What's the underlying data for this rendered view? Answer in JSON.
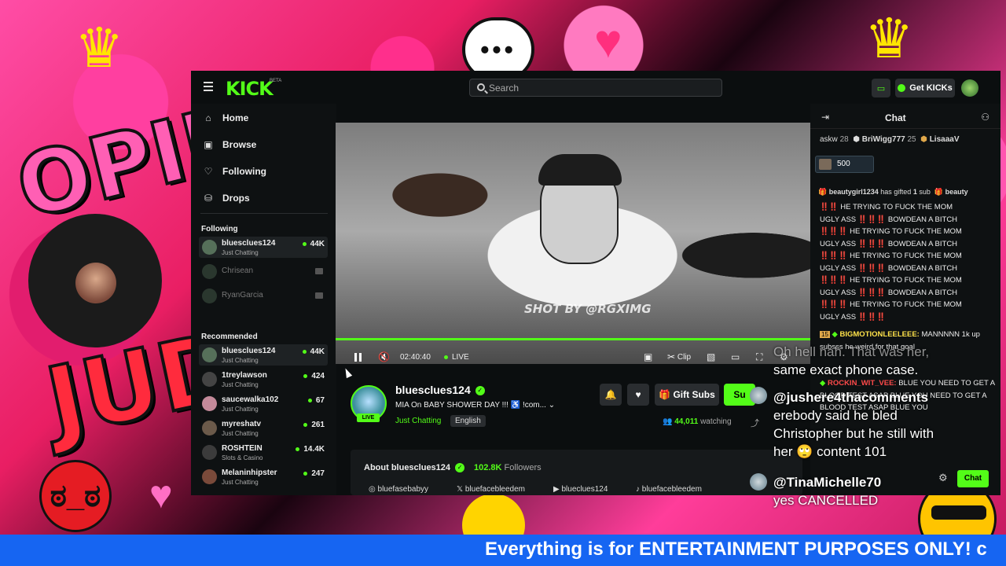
{
  "brand": {
    "logo": "KICK",
    "logo_badge": "BETA",
    "accent": "#53fc18"
  },
  "search": {
    "placeholder": "Search"
  },
  "topbar": {
    "get_kicks_label": "Get KICKs"
  },
  "nav": {
    "items": [
      {
        "label": "Home",
        "icon": "home-icon"
      },
      {
        "label": "Browse",
        "icon": "browse-icon"
      },
      {
        "label": "Following",
        "icon": "heart-icon"
      },
      {
        "label": "Drops",
        "icon": "drops-icon"
      }
    ]
  },
  "following": {
    "heading": "Following",
    "channels": [
      {
        "name": "bluesclues124",
        "category": "Just Chatting",
        "viewers": "44K",
        "live": true
      },
      {
        "name": "Chrisean",
        "live": false
      },
      {
        "name": "RyanGarcia",
        "live": false
      }
    ]
  },
  "recommended": {
    "heading": "Recommended",
    "channels": [
      {
        "name": "bluesclues124",
        "category": "Just Chatting",
        "viewers": "44K"
      },
      {
        "name": "1treylawson",
        "category": "Just Chatting",
        "viewers": "424"
      },
      {
        "name": "saucewalka102",
        "category": "Just Chatting",
        "viewers": "67"
      },
      {
        "name": "myreshatv",
        "category": "Just Chatting",
        "viewers": "261"
      },
      {
        "name": "ROSHTEIN",
        "category": "Slots & Casino",
        "viewers": "14.4K"
      },
      {
        "name": "Melaninhipster",
        "category": "Just Chatting",
        "viewers": "247"
      }
    ]
  },
  "player": {
    "time": "02:40:40",
    "live_label": "LIVE",
    "clip_label": "Clip",
    "watermark": "SHOT BY @RGXIMG"
  },
  "stream": {
    "channel": "bluesclues124",
    "title": "MIA On BABY SHOWER DAY !!! ♿️ !com...",
    "category": "Just Chatting",
    "language": "English",
    "live_badge": "LIVE",
    "viewers": "44,011",
    "viewers_label": "watching",
    "gift_subs_label": "Gift Subs",
    "subscribe_label": "Su"
  },
  "about": {
    "title": "About bluesclues124",
    "followers": "102.8K",
    "followers_label": "Followers",
    "socials": [
      "bluefasebabyy",
      "bluefacebleedem",
      "blueclues124",
      "bluefacebleedem"
    ]
  },
  "chat": {
    "title": "Chat",
    "gifters": [
      {
        "name": "askw",
        "count": "28"
      },
      {
        "name": "BriWigg777",
        "count": "25"
      },
      {
        "name": "LisaaaV",
        "count": ""
      }
    ],
    "pinned_amount": "500",
    "gift_event": {
      "user": "beautygirl1234",
      "text": "has gifted",
      "count": "1",
      "unit": "sub",
      "next": "beauty"
    },
    "spam_lines": [
      "‼️‼️ HE TRYING TO FUCK THE MOM",
      "UGLY ASS ‼️‼️‼️ BOWDEAN A BITCH",
      "‼️‼️‼️ HE TRYING TO FUCK THE MOM",
      "UGLY ASS ‼️‼️‼️ BOWDEAN A BITCH",
      "‼️‼️‼️ HE TRYING TO FUCK THE MOM",
      "UGLY ASS ‼️‼️‼️ BOWDEAN A BITCH",
      "‼️‼️‼️ HE TRYING TO FUCK THE MOM",
      "UGLY ASS ‼️‼️‼️ BOWDEAN A BITCH",
      "‼️‼️‼️ HE TRYING TO FUCK THE MOM",
      "UGLY ASS ‼️‼️‼️"
    ],
    "msg1": {
      "badge": "15",
      "user": "BIGMOTIONLEELEEE:",
      "text": "MANNNNN 1k up subsss he weird for that goal"
    },
    "msg2": {
      "user": "ROCKIN_WIT_VEE:",
      "text": "BLUE YOU NEED TO GET A BLOOD TEST ASAP BLUE YOU NEED TO GET A BLOOD TEST ASAP BLUE YOU"
    },
    "send_label": "Chat"
  },
  "overlay": {
    "line0": "Oh hell nah. That was her,",
    "line0b": "same exact phone case.",
    "user1": "@jushere4thacomments",
    "text1a": "erebody said he bled",
    "text1b": "Christopher but he still with",
    "text1c": "her 🙄 content 101",
    "user2": "@TinaMichelle70",
    "text2": "yes CANCELLED"
  },
  "background": {
    "word1": "OPIN",
    "word2": "JUD"
  },
  "ticker": {
    "text": "Everything is for ENTERTAINMENT PURPOSES ONLY! c"
  }
}
